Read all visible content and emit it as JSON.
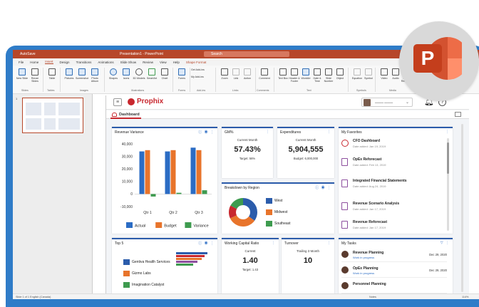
{
  "window": {
    "autosave_label": "AutoSave",
    "title": "Presentation1 - PowerPoint",
    "search_placeholder": "Search"
  },
  "menu_tabs": [
    "File",
    "Home",
    "Insert",
    "Design",
    "Transitions",
    "Animations",
    "Slide Show",
    "Review",
    "View",
    "Help",
    "Shape Format"
  ],
  "active_tab": "Insert",
  "ribbon": {
    "buttons": [
      "New Slide",
      "Reuse Slides",
      "Table",
      "Pictures",
      "Screenshot",
      "Photo Album",
      "Shapes",
      "Icons",
      "3D Models",
      "SmartArt",
      "Chart",
      "Forms",
      "Get Add-ins",
      "My Add-ins",
      "Zoom",
      "Link",
      "Action",
      "Comment",
      "Text Box",
      "Header & Footer",
      "WordArt",
      "Date & Time",
      "Slide Number",
      "Object",
      "Equation",
      "Symbol",
      "Video",
      "Audio",
      "Screen Recording"
    ],
    "groups": [
      "Slides",
      "Tables",
      "Images",
      "Illustrations",
      "Forms",
      "Add-ins",
      "Links",
      "Comments",
      "Text",
      "Symbols",
      "Media"
    ]
  },
  "thumbnails": {
    "slide_number": "1"
  },
  "status": {
    "left": "Slide 1 of 1    English (Canada)",
    "notes": "Notes",
    "zoom": "114%"
  },
  "app": {
    "logo": "Prophix",
    "dashboard_tab": "Dashboard"
  },
  "revenue_variance": {
    "title": "Revenue Variance"
  },
  "gm": {
    "title": "GM%",
    "sub": "Current Month",
    "value": "57.43%",
    "target": "Target: 56%"
  },
  "expenditures": {
    "title": "Expenditures",
    "sub": "Current Month",
    "value": "5,904,555",
    "budget": "Budget: 6,000,000"
  },
  "breakdown": {
    "title": "Breakdown by Region",
    "legend": [
      "West",
      "Midwest",
      "Southeast"
    ],
    "colors": [
      "#2b5cab",
      "#e8742b",
      "#3e9b4f"
    ]
  },
  "favorites": {
    "title": "My Favorites",
    "items": [
      {
        "name": "CFO Dashboard",
        "date": "Date added: Jan 19, 2019"
      },
      {
        "name": "OpEx Reforecast",
        "date": "Date added: Feb 13, 2019"
      },
      {
        "name": "Integrated Financial Statements",
        "date": "Date added: Aug 24, 2019"
      },
      {
        "name": "Revenue Scenario Analysis",
        "date": "Date added: Jan 17, 2019"
      },
      {
        "name": "Revenue Reforecast",
        "date": "Date added: Jan 17, 2019"
      }
    ]
  },
  "top5": {
    "title": "Top 5",
    "items": [
      "Gentiva Health Services",
      "Gizmo Labs",
      "Imagination Catalyst"
    ],
    "colors": [
      "#2b5cab",
      "#e8742b",
      "#3e9b4f"
    ]
  },
  "working_capital": {
    "title": "Working Capital Ratio",
    "sub": "Current",
    "value": "1.40",
    "target": "Target: 1.43"
  },
  "turnover": {
    "title": "Turnover",
    "sub": "Trailing 3 Month",
    "value": "10"
  },
  "tasks": {
    "title": "My Tasks",
    "items": [
      {
        "name": "Revenue Planning",
        "status": "Work in progress",
        "date": "Dec 29, 2020"
      },
      {
        "name": "OpEx Planning",
        "status": "Work in progress",
        "date": "Dec 29, 2020"
      },
      {
        "name": "Personnel Planning",
        "status": "",
        "date": ""
      }
    ]
  },
  "chart_data": {
    "type": "bar",
    "title": "Revenue Variance",
    "categories": [
      "Qtr 1",
      "Qtr 2",
      "Qtr 3"
    ],
    "series": [
      {
        "name": "Actual",
        "values": [
          34000,
          34000,
          37000
        ],
        "color": "#2b6cc4"
      },
      {
        "name": "Budget",
        "values": [
          35000,
          35000,
          35000
        ],
        "color": "#e8742b"
      },
      {
        "name": "Variance",
        "values": [
          -2000,
          1000,
          3000
        ],
        "color": "#3e9b4f"
      }
    ],
    "yticks": [
      "40,000",
      "30,000",
      "20,000",
      "10,000",
      "0",
      "-10,000"
    ],
    "ylim": [
      -10000,
      40000
    ],
    "legend_position": "bottom",
    "grid": false
  }
}
